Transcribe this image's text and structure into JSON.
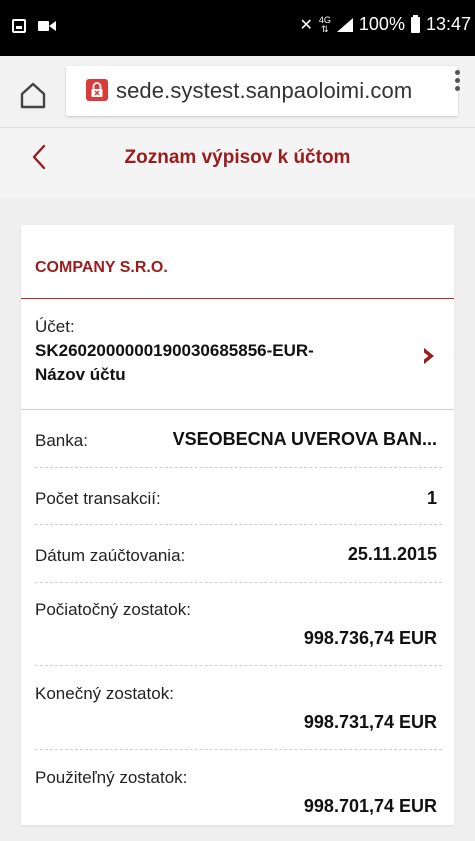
{
  "status_bar": {
    "network": "4G",
    "battery": "100%",
    "time": "13:47"
  },
  "browser": {
    "url": "sede.systest.sanpaoloimi.com"
  },
  "header": {
    "title": "Zoznam výpisov k účtom"
  },
  "card": {
    "company": "COMPANY S.R.O.",
    "account_label": "Účet:",
    "account_number": "SK2602000000190030685856-EUR-",
    "account_name": "Názov účtu",
    "rows": [
      {
        "label": "Banka:",
        "value": "VSEOBECNA UVEROVA BAN..."
      },
      {
        "label": "Počet transakcií:",
        "value": "1"
      },
      {
        "label": "Dátum zaúčtovania:",
        "value": "25.11.2015"
      },
      {
        "label": "Počiatočný zostatok:",
        "value": "998.736,74 EUR"
      },
      {
        "label": "Konečný zostatok:",
        "value": "998.731,74 EUR"
      },
      {
        "label": "Použiteľný zostatok:",
        "value": "998.701,74 EUR"
      }
    ]
  },
  "colors": {
    "accent": "#9b1c1c",
    "background": "#efefef"
  },
  "icons": {
    "back": "chevron-left-icon",
    "account_detail": "chevron-right-icon",
    "home": "home-icon",
    "lock": "lock-warning-icon",
    "menu": "more-vert-icon"
  }
}
